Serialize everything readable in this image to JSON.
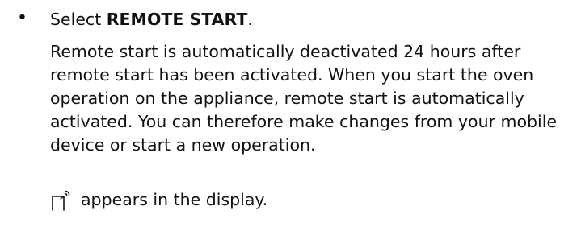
{
  "instruction": {
    "prefix": "Select ",
    "keyword": "REMOTE START",
    "suffix": "."
  },
  "explanation": "Remote start is automatically deactivated 24 hours after remote start has been activated. When you start the oven operation on the appliance, remote start is automatically activated. You can therefore make changes from your mobile device or start a new operation.",
  "result": {
    "icon": "remote-start-icon",
    "text": "appears in the display."
  },
  "colors": {
    "text": "#111111",
    "background": "#ffffff"
  }
}
